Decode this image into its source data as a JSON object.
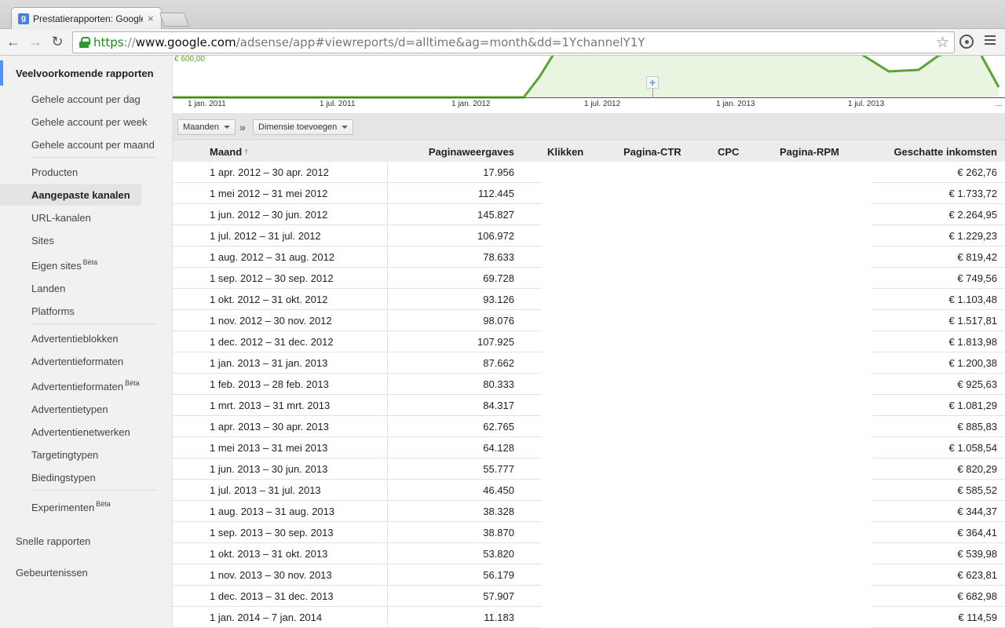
{
  "browser": {
    "tab_title": "Prestatierapporten: Google",
    "tab_close": "×",
    "favicon_letter": "g",
    "url_scheme": "https",
    "url_sep": "://",
    "url_host": "www.google.com",
    "url_path": "/adsense/app#viewreports/d=alltime&ag=month&dd=1YchannelY1Y"
  },
  "sidebar": {
    "header": "Veelvoorkomende rapporten",
    "items": [
      {
        "label": "Gehele account per dag"
      },
      {
        "label": "Gehele account per week"
      },
      {
        "label": "Gehele account per maand"
      },
      {
        "label": "Producten"
      },
      {
        "label": "Aangepaste kanalen",
        "active": true
      },
      {
        "label": "URL-kanalen"
      },
      {
        "label": "Sites"
      },
      {
        "label": "Eigen sites",
        "badge": "Bèta"
      },
      {
        "label": "Landen"
      },
      {
        "label": "Platforms"
      },
      {
        "label": "Advertentieblokken"
      },
      {
        "label": "Advertentieformaten"
      },
      {
        "label": "Advertentieformaten",
        "badge": "Bèta"
      },
      {
        "label": "Advertentietypen"
      },
      {
        "label": "Advertentienetwerken"
      },
      {
        "label": "Targetingtypen"
      },
      {
        "label": "Biedingstypen"
      },
      {
        "label": "Experimenten",
        "badge": "Bèta"
      }
    ],
    "quick_reports": "Snelle rapporten",
    "events": "Gebeurtenissen"
  },
  "chart": {
    "y_label": "€ 600,00",
    "x_ticks": [
      "1 jan. 2011",
      "1 jul. 2011",
      "1 jan. 2012",
      "1 jul. 2012",
      "1 jan. 2013",
      "1 jul. 2013",
      "..."
    ],
    "plus": "+",
    "line_color": "#5ba332",
    "fill_color": "#eaf5e1"
  },
  "controls": {
    "period": "Maanden",
    "separator": "»",
    "add_dimension": "Dimensie toevoegen"
  },
  "table": {
    "headers": {
      "month": "Maand",
      "sort_arrow": "↑",
      "views": "Paginaweergaves",
      "clicks": "Klikken",
      "ctr": "Pagina-CTR",
      "cpc": "CPC",
      "rpm": "Pagina-RPM",
      "earnings": "Geschatte inkomsten"
    },
    "rows": [
      {
        "month": "1 apr. 2012 – 30 apr. 2012",
        "views": "17.956",
        "earnings": "€ 262,76"
      },
      {
        "month": "1 mei 2012 – 31 mei 2012",
        "views": "112.445",
        "earnings": "€ 1.733,72"
      },
      {
        "month": "1 jun. 2012 – 30 jun. 2012",
        "views": "145.827",
        "earnings": "€ 2.264,95"
      },
      {
        "month": "1 jul. 2012 – 31 jul. 2012",
        "views": "106.972",
        "earnings": "€ 1.229,23"
      },
      {
        "month": "1 aug. 2012 – 31 aug. 2012",
        "views": "78.633",
        "earnings": "€ 819,42"
      },
      {
        "month": "1 sep. 2012 – 30 sep. 2012",
        "views": "69.728",
        "earnings": "€ 749,56"
      },
      {
        "month": "1 okt. 2012 – 31 okt. 2012",
        "views": "93.126",
        "earnings": "€ 1.103,48"
      },
      {
        "month": "1 nov. 2012 – 30 nov. 2012",
        "views": "98.076",
        "earnings": "€ 1.517,81"
      },
      {
        "month": "1 dec. 2012 – 31 dec. 2012",
        "views": "107.925",
        "earnings": "€ 1.813,98"
      },
      {
        "month": "1 jan. 2013 – 31 jan. 2013",
        "views": "87.662",
        "earnings": "€ 1.200,38"
      },
      {
        "month": "1 feb. 2013 – 28 feb. 2013",
        "views": "80.333",
        "earnings": "€ 925,63"
      },
      {
        "month": "1 mrt. 2013 – 31 mrt. 2013",
        "views": "84.317",
        "earnings": "€ 1.081,29"
      },
      {
        "month": "1 apr. 2013 – 30 apr. 2013",
        "views": "62.765",
        "earnings": "€ 885,83"
      },
      {
        "month": "1 mei 2013 – 31 mei 2013",
        "views": "64.128",
        "earnings": "€ 1.058,54"
      },
      {
        "month": "1 jun. 2013 – 30 jun. 2013",
        "views": "55.777",
        "earnings": "€ 820,29"
      },
      {
        "month": "1 jul. 2013 – 31 jul. 2013",
        "views": "46.450",
        "earnings": "€ 585,52"
      },
      {
        "month": "1 aug. 2013 – 31 aug. 2013",
        "views": "38.328",
        "earnings": "€ 344,37"
      },
      {
        "month": "1 sep. 2013 – 30 sep. 2013",
        "views": "38.870",
        "earnings": "€ 364,41"
      },
      {
        "month": "1 okt. 2013 – 31 okt. 2013",
        "views": "53.820",
        "earnings": "€ 539,98"
      },
      {
        "month": "1 nov. 2013 – 30 nov. 2013",
        "views": "56.179",
        "earnings": "€ 623,81"
      },
      {
        "month": "1 dec. 2013 – 31 dec. 2013",
        "views": "57.907",
        "earnings": "€ 682,98"
      },
      {
        "month": "1 jan. 2014 – 7 jan. 2014",
        "views": "11.183",
        "earnings": "€ 114,59"
      }
    ]
  }
}
